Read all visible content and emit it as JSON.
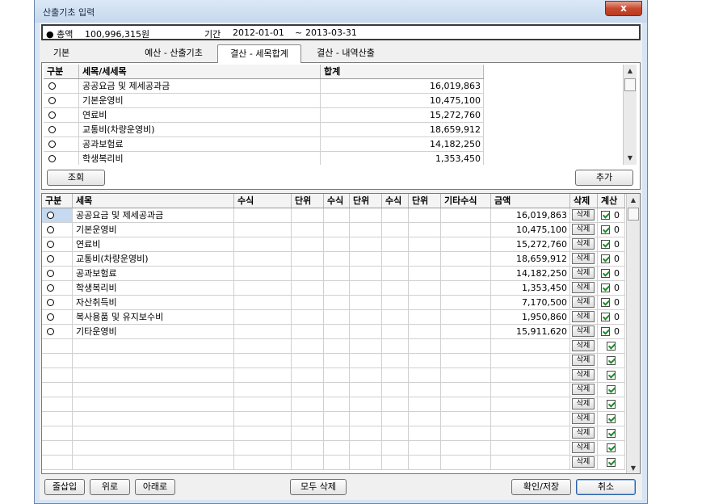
{
  "window": {
    "title": "산출기초 입력",
    "close_label": "x"
  },
  "info": {
    "total_label": "● 총액",
    "total_value": "100,996,315원",
    "period_label": "기간",
    "start": "2012-01-01",
    "tilde": "~",
    "end": "2013-03-31"
  },
  "tabs": [
    {
      "label": "기본"
    },
    {
      "label": "예산 - 산출기초"
    },
    {
      "label": "결산 - 세목합계",
      "active": true
    },
    {
      "label": "결산 - 내역산출"
    }
  ],
  "top_grid": {
    "headers": {
      "type": "구분",
      "item": "세목/세세목",
      "total": "합계"
    },
    "rows": [
      {
        "item": "공공요금 및 제세공과금",
        "total": "16,019,863"
      },
      {
        "item": "기본운영비",
        "total": "10,475,100"
      },
      {
        "item": "연료비",
        "total": "15,272,760"
      },
      {
        "item": "교통비(차량운영비)",
        "total": "18,659,912"
      },
      {
        "item": "공과보험료",
        "total": "14,182,250"
      },
      {
        "item": "학생복리비",
        "total": "1,353,450"
      }
    ]
  },
  "buttons": {
    "query": "조회",
    "add": "추가",
    "insert_row": "줄삽입",
    "up": "위로",
    "down": "아래로",
    "delete_all": "모두 삭제",
    "confirm": "확인/저장",
    "cancel": "취소",
    "row_delete": "삭제"
  },
  "bottom_grid": {
    "headers": {
      "type": "구분",
      "item": "세목",
      "formula1": "수식",
      "unit1": "단위",
      "formula2": "수식",
      "unit2": "단위",
      "formula3": "수식",
      "unit3": "단위",
      "other_formula": "기타수식",
      "amount": "금액",
      "delete": "삭제",
      "calc": "계산"
    },
    "rows": [
      {
        "item": "공공요금 및 제세공과금",
        "amount": "16,019,863",
        "calc": "0"
      },
      {
        "item": "기본운영비",
        "amount": "10,475,100",
        "calc": "0"
      },
      {
        "item": "연료비",
        "amount": "15,272,760",
        "calc": "0"
      },
      {
        "item": "교통비(차량운영비)",
        "amount": "18,659,912",
        "calc": "0"
      },
      {
        "item": "공과보험료",
        "amount": "14,182,250",
        "calc": "0"
      },
      {
        "item": "학생복리비",
        "amount": "1,353,450",
        "calc": "0"
      },
      {
        "item": "자산취득비",
        "amount": "7,170,500",
        "calc": "0"
      },
      {
        "item": "복사용품 및 유지보수비",
        "amount": "1,950,860",
        "calc": "0"
      },
      {
        "item": "기타운영비",
        "amount": "15,911,620",
        "calc": "0"
      }
    ],
    "empty_rows": 9
  }
}
